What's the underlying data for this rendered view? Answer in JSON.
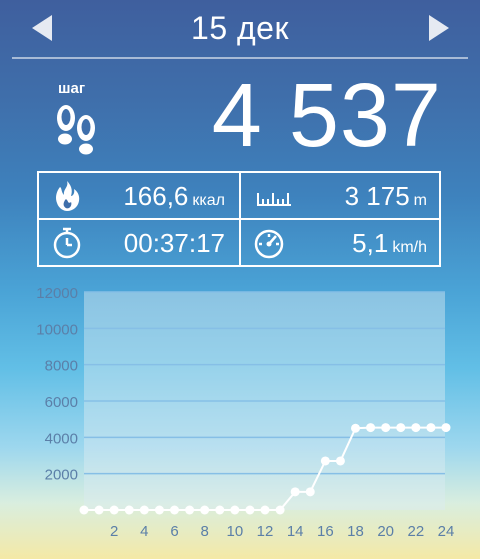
{
  "header": {
    "date": "15 дек",
    "prev_icon": "chevron-left-icon",
    "next_icon": "chevron-right-icon"
  },
  "steps": {
    "label": "шаг",
    "value": "4 537",
    "icon": "footprints-icon"
  },
  "stats": {
    "calories": {
      "value": "166,6",
      "unit": "ккал",
      "icon": "flame-icon"
    },
    "distance": {
      "value": "3 175",
      "unit": "m",
      "icon": "ruler-icon"
    },
    "duration": {
      "value": "00:37:17",
      "icon": "stopwatch-icon"
    },
    "speed": {
      "value": "5,1",
      "unit": "km/h",
      "icon": "speedometer-icon"
    }
  },
  "chart_data": {
    "type": "line",
    "title": "",
    "xlabel": "",
    "ylabel": "",
    "x": [
      0,
      1,
      2,
      3,
      4,
      5,
      6,
      7,
      8,
      9,
      10,
      11,
      12,
      13,
      14,
      15,
      16,
      17,
      18,
      19,
      20,
      21,
      22,
      23,
      24
    ],
    "x_tick_labels": [
      "2",
      "4",
      "6",
      "8",
      "10",
      "12",
      "14",
      "16",
      "18",
      "20",
      "22",
      "24"
    ],
    "x_ticks": [
      2,
      4,
      6,
      8,
      10,
      12,
      14,
      16,
      18,
      20,
      22,
      24
    ],
    "values": [
      0,
      0,
      0,
      0,
      0,
      0,
      0,
      0,
      0,
      0,
      0,
      0,
      0,
      0,
      1000,
      1000,
      2700,
      2700,
      4500,
      4537,
      4537,
      4537,
      4537,
      4537,
      4537
    ],
    "y_ticks": [
      2000,
      4000,
      6000,
      8000,
      10000,
      12000
    ],
    "y_tick_labels": [
      "2000",
      "4000",
      "6000",
      "8000",
      "10000",
      "12000"
    ],
    "ylim": [
      0,
      12000
    ],
    "xlim": [
      0,
      24
    ],
    "grid": true,
    "line_color": "#ffffff",
    "grid_color": "#86bfe6",
    "plot_background": "#dceaf2"
  }
}
